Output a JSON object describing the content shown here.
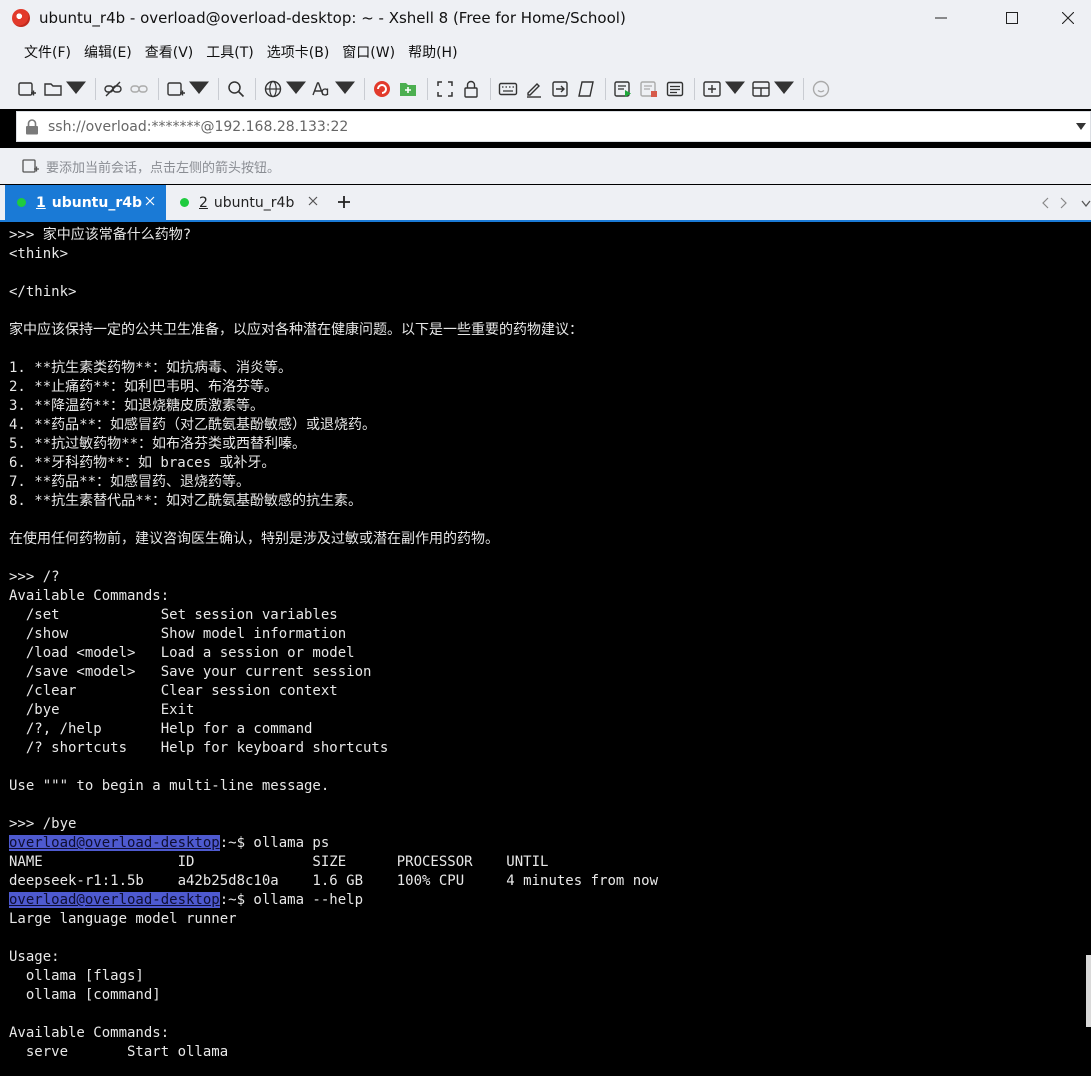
{
  "window": {
    "title": "ubuntu_r4b - overload@overload-desktop: ~ - Xshell 8 (Free for Home/School)",
    "controls": [
      "minimize-icon",
      "maximize-icon",
      "close-icon"
    ]
  },
  "menu": {
    "items": [
      "文件(F)",
      "编辑(E)",
      "查看(V)",
      "工具(T)",
      "选项卡(B)",
      "窗口(W)",
      "帮助(H)"
    ]
  },
  "toolbar": {
    "icons": [
      "new-session-icon",
      "open-folder-icon",
      "disconnect-icon",
      "link-icon",
      "new-tab-icon",
      "search-icon",
      "globe-icon",
      "font-icon",
      "xshell-logo-icon",
      "xftp-icon",
      "fullscreen-icon",
      "lock-icon",
      "keyboard-icon",
      "compose-icon",
      "transfer-icon",
      "script-icon",
      "log-icon",
      "record-icon",
      "notes-icon",
      "add-window-icon",
      "layout-icon",
      "chat-icon"
    ]
  },
  "address": {
    "value": "ssh://overload:*******@192.168.28.133:22"
  },
  "hint": {
    "text": "要添加当前会话，点击左侧的箭头按钮。"
  },
  "tabs": [
    {
      "number": "1",
      "name": "ubuntu_r4b",
      "active": true,
      "status_color": "#1fcb3f"
    },
    {
      "number": "2",
      "name": "ubuntu_r4b",
      "active": false,
      "status_color": "#1fcb3f"
    }
  ],
  "terminal": {
    "user_host": "overload@overload-desktop",
    "lines": [
      {
        "text": ">>> 家中应该常备什么药物?"
      },
      {
        "text": "<think>"
      },
      {
        "text": ""
      },
      {
        "text": "</think>"
      },
      {
        "text": ""
      },
      {
        "text": "家中应该保持一定的公共卫生准备，以应对各种潜在健康问题。以下是一些重要的药物建议："
      },
      {
        "text": ""
      },
      {
        "text": "1. **抗生素类药物**：如抗病毒、消炎等。"
      },
      {
        "text": "2. **止痛药**：如利巴韦明、布洛芬等。"
      },
      {
        "text": "3. **降温药**：如退烧糖皮质激素等。"
      },
      {
        "text": "4. **药品**：如感冒药（对乙酰氨基酚敏感）或退烧药。"
      },
      {
        "text": "5. **抗过敏药物**：如布洛芬类或西替利嗪。"
      },
      {
        "text": "6. **牙科药物**：如 braces 或补牙。"
      },
      {
        "text": "7. **药品**：如感冒药、退烧药等。"
      },
      {
        "text": "8. **抗生素替代品**：如对乙酰氨基酚敏感的抗生素。"
      },
      {
        "text": ""
      },
      {
        "text": "在使用任何药物前，建议咨询医生确认，特别是涉及过敏或潜在副作用的药物。"
      },
      {
        "text": ""
      },
      {
        "text": ">>> /?"
      },
      {
        "text": "Available Commands:"
      },
      {
        "text": "  /set            Set session variables"
      },
      {
        "text": "  /show           Show model information"
      },
      {
        "text": "  /load <model>   Load a session or model"
      },
      {
        "text": "  /save <model>   Save your current session"
      },
      {
        "text": "  /clear          Clear session context"
      },
      {
        "text": "  /bye            Exit"
      },
      {
        "text": "  /?, /help       Help for a command"
      },
      {
        "text": "  /? shortcuts    Help for keyboard shortcuts"
      },
      {
        "text": ""
      },
      {
        "text": "Use \"\"\" to begin a multi-line message."
      },
      {
        "text": ""
      },
      {
        "text": ">>> /bye"
      },
      {
        "prompt": "overload@overload-desktop",
        "text": ":~$ ollama ps"
      },
      {
        "text": "NAME                ID              SIZE      PROCESSOR    UNTIL"
      },
      {
        "text": "deepseek-r1:1.5b    a42b25d8c10a    1.6 GB    100% CPU     4 minutes from now"
      },
      {
        "prompt": "overload@overload-desktop",
        "text": ":~$ ollama --help"
      },
      {
        "text": "Large language model runner"
      },
      {
        "text": ""
      },
      {
        "text": "Usage:"
      },
      {
        "text": "  ollama [flags]"
      },
      {
        "text": "  ollama [command]"
      },
      {
        "text": ""
      },
      {
        "text": "Available Commands:"
      },
      {
        "text": "  serve       Start ollama"
      }
    ]
  },
  "colors": {
    "chrome_bg": "#eef0f4",
    "tab_active": "#1a7ad6",
    "status_dot": "#1fcb3f",
    "prompt_highlight": "#4e5ad0",
    "terminal_bg": "#000000",
    "terminal_fg": "#e8e8e8"
  }
}
